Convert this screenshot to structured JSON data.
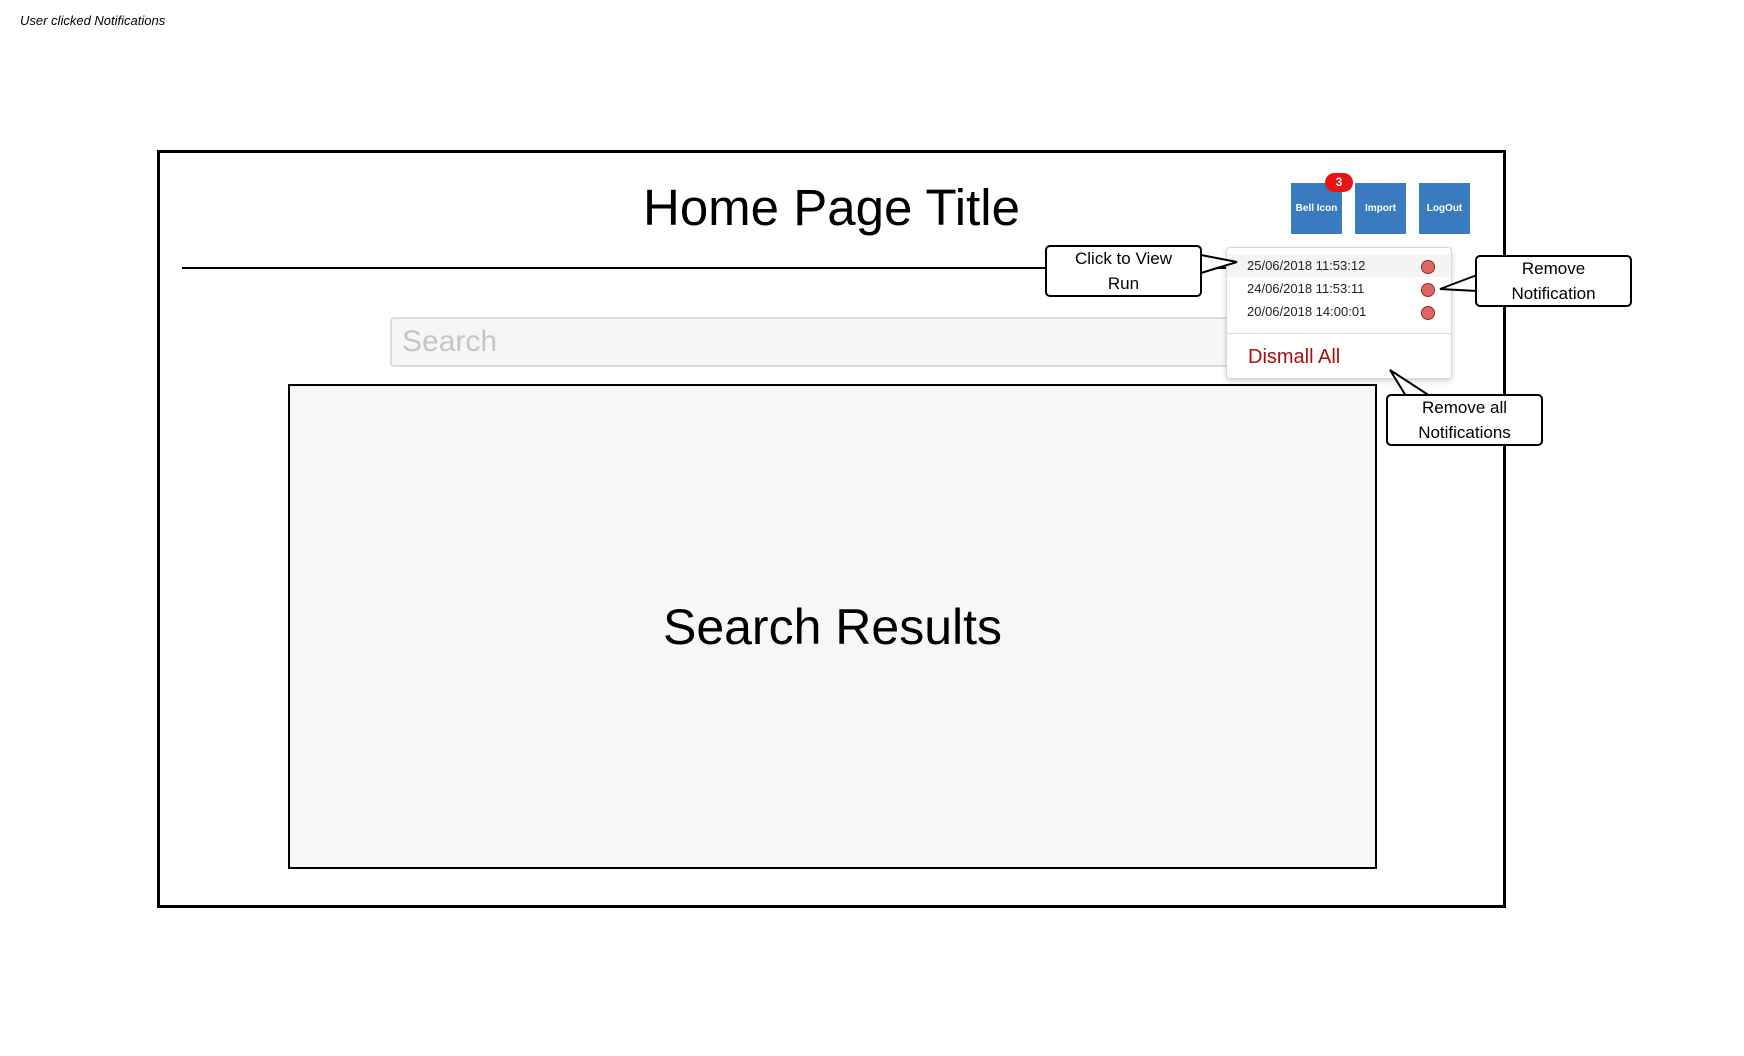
{
  "annotation": "User clicked Notifications",
  "page": {
    "title": "Home Page Title"
  },
  "header_buttons": {
    "bell": "Bell Icon",
    "bell_badge": "3",
    "import": "Import",
    "logout": "LogOut"
  },
  "search": {
    "placeholder": "Search"
  },
  "results": {
    "label": "Search Results"
  },
  "notifications": {
    "items": [
      {
        "time": "25/06/2018 11:53:12"
      },
      {
        "time": "24/06/2018 11:53:11"
      },
      {
        "time": "20/06/2018 14:00:01"
      }
    ],
    "dismiss_all": "Dismall All"
  },
  "callouts": {
    "view_run": "Click to View Run",
    "remove_notification": "Remove Notification",
    "remove_all": "Remove all Notifications"
  },
  "colors": {
    "button_blue": "#3a7abf",
    "badge_red": "#e81414",
    "remove_dot": "#e06666",
    "dismiss_text": "#a60f0f"
  }
}
